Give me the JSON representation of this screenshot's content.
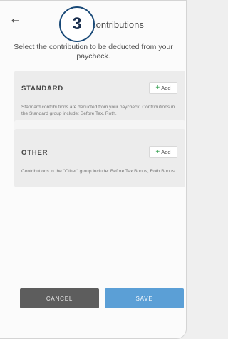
{
  "header": {
    "back_icon": "←",
    "step_number": "3",
    "title": "y contributions"
  },
  "instruction": "Select the contribution to be deducted from your paycheck.",
  "groups": [
    {
      "name": "STANDARD",
      "add_label": "Add",
      "description": "Standard contributions are deducted from your paycheck. Contributions in the Standard group include: Before Tax, Roth."
    },
    {
      "name": "OTHER",
      "add_label": "Add",
      "description": "Contributions in the \"Other\" group include: Before Tax Bonus, Roth Bonus."
    }
  ],
  "actions": {
    "cancel_label": "CANCEL",
    "save_label": "SAVE"
  },
  "colors": {
    "badge_border": "#1a4a78",
    "cancel_bg": "#5d5d5d",
    "save_bg": "#5b9fd6",
    "card_bg": "#ececec"
  }
}
